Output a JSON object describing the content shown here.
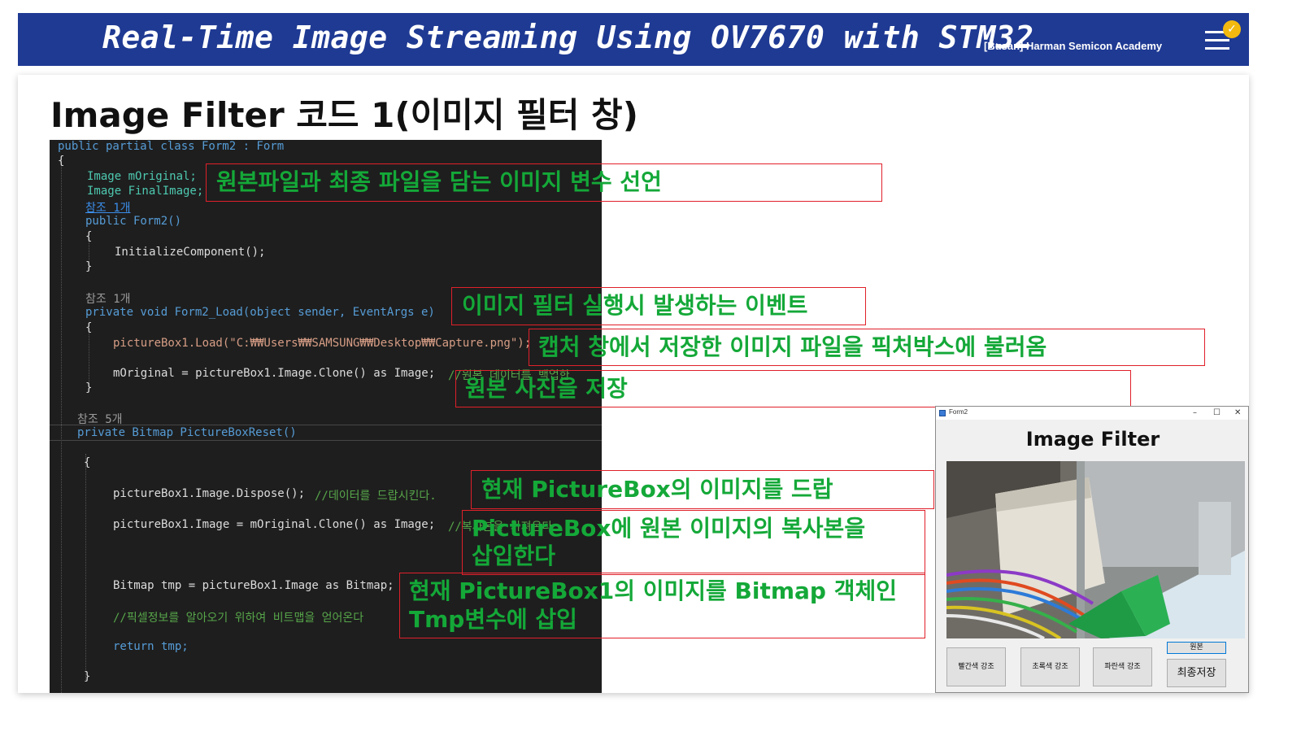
{
  "header": {
    "title": "Real-Time Image Streaming Using OV7670 with STM32",
    "subtitle": "[Busan] Harman Semicon Academy",
    "badge": "✓"
  },
  "slide": {
    "title": "Image Filter 코드 1(이미지 필터 창)"
  },
  "code": {
    "l1": "public partial class Form2 : Form",
    "brace_open": "{",
    "brace_close": "}",
    "l3a": "Image mOriginal;",
    "l3b": "Image FinalImage;",
    "ref_1": "참조 1개",
    "ref_1_link": "참조 1개",
    "ref_5": "참조 5개",
    "ctor": "public Form2()",
    "init": "InitializeComponent();",
    "load_sig": "private void Form2_Load(object sender, EventArgs e)",
    "load_pic": "pictureBox1.Load(\"C:₩₩Users₩₩SAMSUNG₩₩Desktop₩₩Capture.png\");",
    "clone_orig": "mOriginal = pictureBox1.Image.Clone() as Image;",
    "clone_orig_comment": "//원본 데이터를 백업한",
    "reset_sig": "private Bitmap PictureBoxReset()",
    "dispose": "pictureBox1.Image.Dispose();",
    "dispose_comment": "//데이터를 드랍시킨다.",
    "reassign": "pictureBox1.Image = mOriginal.Clone() as Image;",
    "reassign_comment": "//복사본을 가져온다",
    "bitmap": "Bitmap tmp = pictureBox1.Image as Bitmap;",
    "pixel_comment": "//픽셀정보를 알아오기 위하여 비트맵을 얻어온다",
    "ret": "return tmp;"
  },
  "callouts": {
    "c1": "원본파일과 최종 파일을 담는 이미지 변수 선언",
    "c2": "이미지 필터 실행시 발생하는 이벤트",
    "c3": "캡처 창에서 저장한 이미지 파일을 픽처박스에 불러옴",
    "c4": "원본 사진을 저장",
    "c5": "현재 PictureBox의 이미지를 드랍",
    "c6a": "PictureBox에 원본 이미지의 복사본을",
    "c6b": "삽입한다",
    "c7a": "현재 PictureBox1의 이미지를 Bitmap 객체인",
    "c7b": "Tmp변수에 삽입"
  },
  "form": {
    "window_title": "Form2",
    "minimize": "–",
    "maximize": "☐",
    "close": "✕",
    "heading": "Image Filter",
    "btn_red": "빨간색 강조",
    "btn_green": "초록색 강조",
    "btn_blue": "파란색 강조",
    "btn_original": "원본",
    "btn_final_save": "최종저장"
  },
  "colors": {
    "header_bg": "#1f3a93",
    "callout_border": "#e0202a",
    "callout_text": "#14a838"
  },
  "icons": {
    "menu": "hamburger-menu-icon",
    "badge": "check-badge-icon"
  }
}
